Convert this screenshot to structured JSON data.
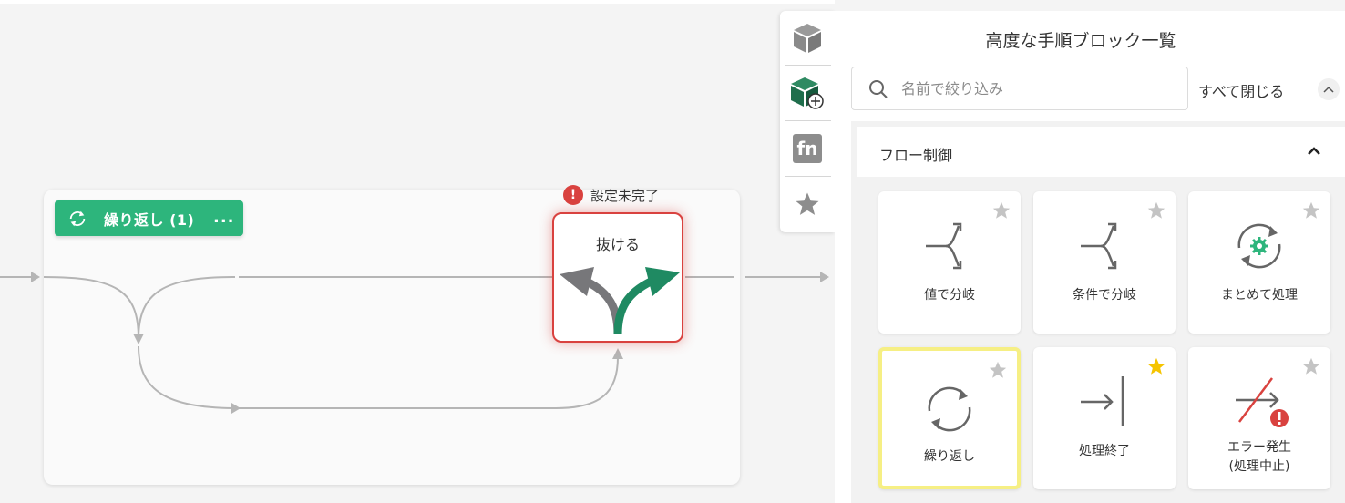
{
  "canvas": {
    "loop_badge": {
      "label": "繰り返し (1)",
      "more": "..."
    },
    "warning": {
      "icon": "!",
      "text": "設定未完了"
    },
    "exit_block": {
      "title": "抜ける"
    }
  },
  "side_toolbar": {
    "items": [
      {
        "icon": "cube-icon"
      },
      {
        "icon": "cube-add-icon"
      },
      {
        "icon": "function-icon",
        "text": "fn"
      },
      {
        "icon": "star-icon"
      }
    ]
  },
  "panel": {
    "title": "高度な手順ブロック一覧",
    "search_placeholder": "名前で絞り込み",
    "close_all": "すべて閉じる",
    "section": {
      "label": "フロー制御"
    },
    "cards": [
      {
        "label": "値で分岐",
        "icon": "branch-by-value-icon",
        "starred": false
      },
      {
        "label": "条件で分岐",
        "icon": "branch-by-condition-icon",
        "starred": false
      },
      {
        "label": "まとめて処理",
        "icon": "batch-process-icon",
        "starred": false
      },
      {
        "label": "繰り返し",
        "icon": "repeat-icon",
        "starred": false,
        "selected": true
      },
      {
        "label": "処理終了",
        "icon": "end-process-icon",
        "starred": true
      },
      {
        "label_line1": "エラー発生",
        "label_line2": "(処理中止)",
        "icon": "raise-error-icon",
        "starred": false
      }
    ]
  },
  "colors": {
    "accent_green": "#2db57c",
    "error_red": "#d9423f",
    "star_gold": "#f5c400",
    "star_gray": "#c4c4c4"
  }
}
